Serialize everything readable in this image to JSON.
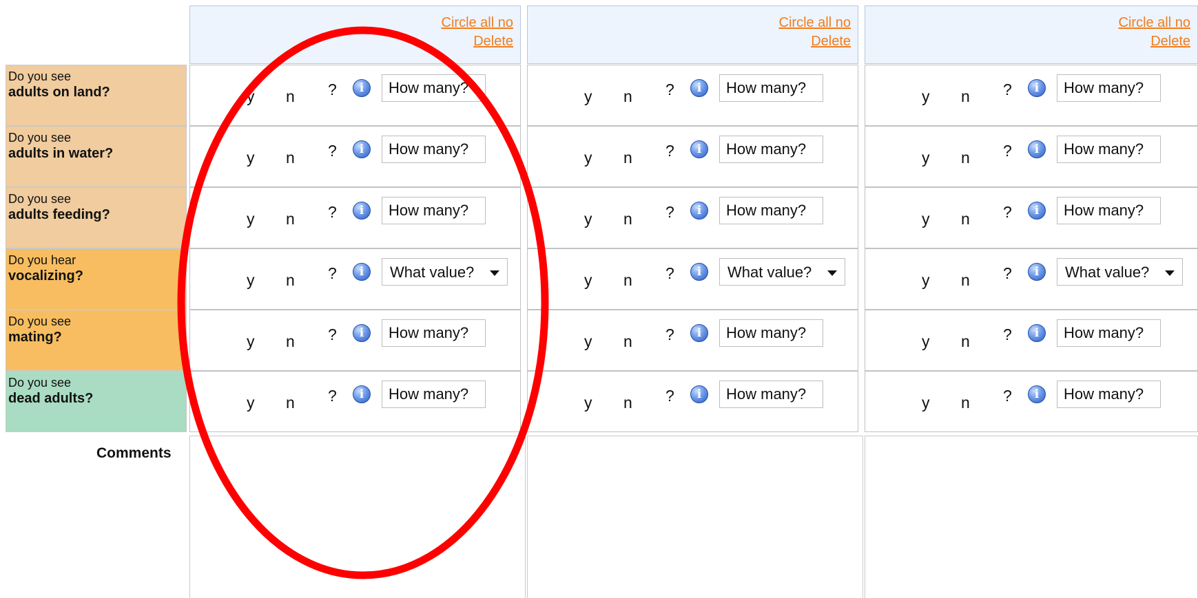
{
  "columns": [
    {
      "circle_all_no": "Circle all no",
      "delete": "Delete"
    },
    {
      "circle_all_no": "Circle all no",
      "delete": "Delete"
    },
    {
      "circle_all_no": "Circle all no",
      "delete": "Delete"
    }
  ],
  "questions": [
    {
      "prefix": "Do you see",
      "subject": "adults on land?",
      "color": "#f0cc9e",
      "input_kind": "count"
    },
    {
      "prefix": "Do you see",
      "subject": "adults in water?",
      "color": "#f0cc9e",
      "input_kind": "count"
    },
    {
      "prefix": "Do you see",
      "subject": "adults feeding?",
      "color": "#f0cc9e",
      "input_kind": "count"
    },
    {
      "prefix": "Do you hear",
      "subject": "vocalizing?",
      "color": "#f7bd60",
      "input_kind": "value"
    },
    {
      "prefix": "Do you see",
      "subject": "mating?",
      "color": "#f7bd60",
      "input_kind": "count"
    },
    {
      "prefix": "Do you see",
      "subject": "dead adults?",
      "color": "#a9dcc2",
      "input_kind": "count"
    }
  ],
  "answer_options": {
    "yes": "y",
    "no": "n",
    "unknown": "?"
  },
  "info_icon_glyph": "i",
  "count_placeholder": "How many?",
  "value_placeholder": "What value?",
  "comments_label": "Comments",
  "colors": {
    "link": "#f07d1e",
    "header_bg": "#edf4fd",
    "annotation": "#ff0000"
  },
  "annotation": "red ellipse highlighting the first column"
}
